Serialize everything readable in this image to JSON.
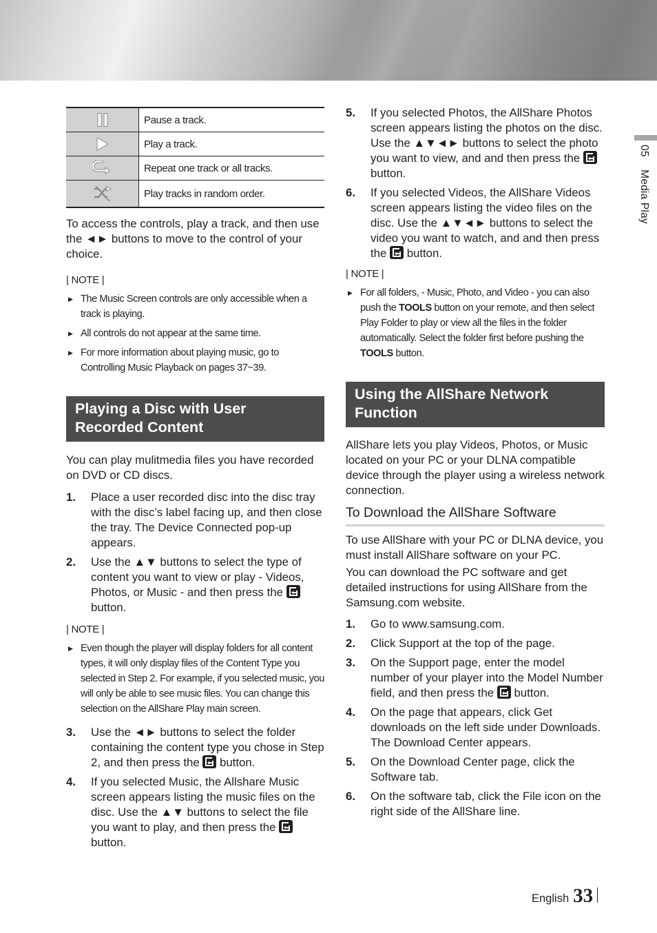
{
  "side_tab": {
    "chapter_number": "05",
    "chapter_title": "Media Play"
  },
  "control_table": [
    {
      "icon": "pause-icon",
      "label": "Pause a track."
    },
    {
      "icon": "play-icon",
      "label": "Play a track."
    },
    {
      "icon": "repeat-icon",
      "label": "Repeat one track or all tracks."
    },
    {
      "icon": "shuffle-icon",
      "label": "Play tracks in random order."
    }
  ],
  "left": {
    "intro": "To access the controls, play a track, and then use the ◄► buttons to move to the control of your choice.",
    "note_label": "| NOTE |",
    "notes": [
      "The Music Screen controls are only accessible when a track is playing.",
      "All controls do not appear at the same time.",
      "For more information about playing music, go to Controlling Music Playback on pages 37~39."
    ],
    "section_title": "Playing a Disc with User Recorded Content",
    "section_intro": "You can play mulitmedia files you have recorded on DVD or CD discs.",
    "steps_a": [
      {
        "n": "1.",
        "text": "Place a user recorded disc into the disc tray with the disc’s label facing up, and then close the tray. The Device Connected pop-up appears."
      },
      {
        "n": "2.",
        "text_before": "Use the ▲▼ buttons to select the type of content you want to view or play - Videos, Photos, or Music - and then press the",
        "text_after": "button."
      }
    ],
    "note2_label": "| NOTE |",
    "notes2": [
      "Even though the player will display folders for all content types, it will only display files of the Content Type you selected in Step 2. For example, if you selected music, you will only be able to see music files. You can change this selection on the AllShare Play main screen."
    ],
    "steps_b": [
      {
        "n": "3.",
        "text_before": "Use the ◄► buttons to select the folder containing the content type you chose in Step 2, and then press the",
        "text_after": "button."
      },
      {
        "n": "4.",
        "text_before": "If you selected Music, the Allshare Music screen appears listing the music files on the disc. Use the ▲▼ buttons to select the file you want to play, and then press the",
        "text_after": "button."
      }
    ]
  },
  "right": {
    "steps_c": [
      {
        "n": "5.",
        "text_before": "If you selected Photos, the AllShare Photos screen appears listing the photos on the disc. Use the ▲▼◄► buttons to select the photo you want to view, and and then press the",
        "text_after": "button."
      },
      {
        "n": "6.",
        "text_before": "If you selected Videos, the AllShare Videos screen appears listing the video files on the disc. Use the ▲▼◄► buttons to select the video you want to watch, and and then press the",
        "text_after": "button."
      }
    ],
    "note_label": "| NOTE |",
    "note": {
      "part1": "For all folders, - Music, Photo, and Video - you can also push the",
      "bold1": "TOOLS",
      "part2": "button on your remote, and then select Play Folder to play or view all the files in the folder automatically. Select the folder first before pushing the",
      "bold2": "TOOLS",
      "part3": "button."
    },
    "section_title": "Using the AllShare Network Function",
    "section_intro": "AllShare lets you play Videos, Photos, or Music located on your PC or your DLNA compatible device through the player using a wireless network connection.",
    "sub_title": "To Download the AllShare Software",
    "sub_para1": "To use AllShare with your PC or DLNA device, you must install AllShare software on your PC.",
    "sub_para2": "You can download the PC software and get detailed instructions for using AllShare from the Samsung.com website.",
    "download_steps": [
      {
        "n": "1.",
        "text": "Go to www.samsung.com."
      },
      {
        "n": "2.",
        "text": "Click Support at the top of the page."
      },
      {
        "n": "3.",
        "text_before": "On the Support page, enter the model number of your player into the Model Number field, and then press the",
        "text_after": "button."
      },
      {
        "n": "4.",
        "text": "On the page that appears, click Get downloads on the left side under Downloads. The Download Center appears."
      },
      {
        "n": "5.",
        "text": "On the Download Center page, click the Software tab."
      },
      {
        "n": "6.",
        "text": "On the software tab, click the File icon on the right side of the AllShare line."
      }
    ]
  },
  "footer": {
    "language": "English",
    "page_number": "33"
  }
}
